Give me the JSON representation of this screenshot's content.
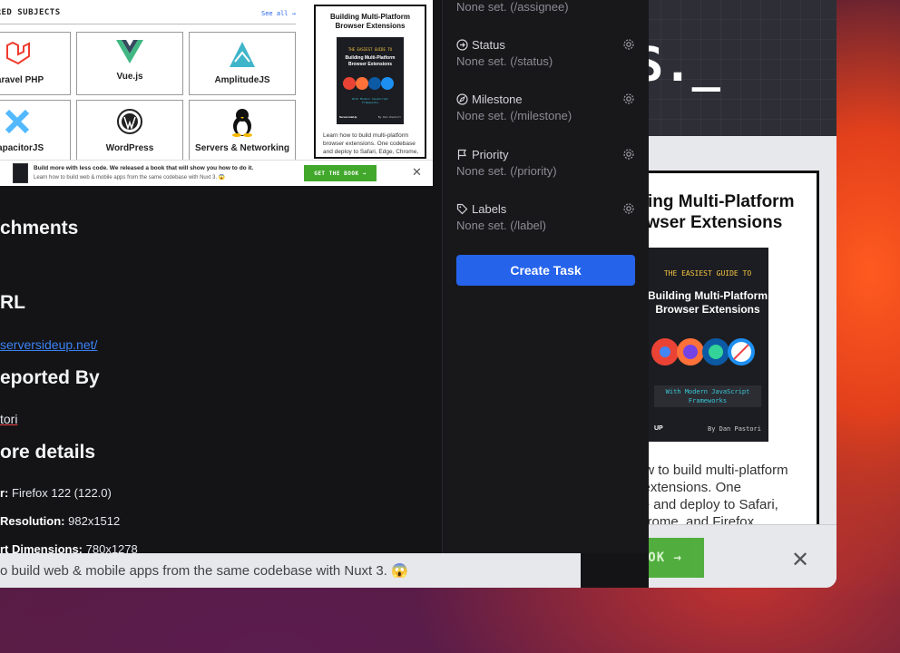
{
  "background_window": {
    "header_logo": "S._",
    "book_title": "Building Multi-Platform Browser Extensions",
    "cover_kicker": "THE EASIEST GUIDE TO",
    "cover_title": "Building Multi-Platform Browser Extensions",
    "cover_subtitle": "With Modern JavaScript Frameworks",
    "cover_brand": "UP",
    "cover_author": "By Dan Pastori",
    "book_description": "Learn how to build multi-platform browser extensions. One codebase and deploy to Safari, Edge, Chrome, and Firefox.",
    "banner_button": "GET THE BOOK →",
    "banner_close": "✕"
  },
  "preview": {
    "section_header": "FEATURED SUBJECTS",
    "see_all": "See all →",
    "subjects": [
      {
        "label": "Laravel PHP",
        "icon": "laravel-icon"
      },
      {
        "label": "Vue.js",
        "icon": "vue-icon"
      },
      {
        "label": "AmplitudeJS",
        "icon": "amplitude-icon"
      },
      {
        "label": "CapacitorJS",
        "icon": "capacitor-icon"
      },
      {
        "label": "WordPress",
        "icon": "wordpress-icon"
      },
      {
        "label": "Servers & Networking",
        "icon": "linux-icon"
      }
    ],
    "book_title": "Building Multi-Platform Browser Extensions",
    "cover_kicker": "THE EASIEST GUIDE TO",
    "cover_title": "Building Multi-Platform Browser Extensions",
    "cover_subtitle": "With Modern JavaScript Frameworks",
    "cover_brand": "ServersideUp",
    "cover_author": "By Dan Pastori",
    "book_description": "Learn how to build multi-platform browser extensions. One codebase and deploy to Safari, Edge, Chrome, and Firefox.",
    "promo_title": "Build more with less code. We released a book that will show you how to do it.",
    "promo_subtitle": "Learn how to build web & mobile apps from the same codebase with Nuxt 3. 😱",
    "promo_button": "GET THE BOOK →",
    "promo_close": "✕"
  },
  "details": {
    "attachments_heading": "chments",
    "url_heading": "RL",
    "url_value": "serversideup.net/",
    "reported_by_heading": "eported By",
    "reporter": "tori",
    "more_details_heading": "ore details",
    "browser_label": "r:",
    "browser_value": "Firefox 122 (122.0)",
    "resolution_label": "Resolution:",
    "resolution_value": "982x1512",
    "viewport_label": "rt Dimensions:",
    "viewport_value": "780x1278",
    "bottom_strip_text": "o build web & mobile apps from the same codebase with Nuxt 3. 😱"
  },
  "sidebar": {
    "assignee_value": "None set. (/assignee)",
    "fields": [
      {
        "label": "Status",
        "value": "None set. (/status)",
        "icon": "status-icon"
      },
      {
        "label": "Milestone",
        "value": "None set. (/milestone)",
        "icon": "milestone-icon"
      },
      {
        "label": "Priority",
        "value": "None set. (/priority)",
        "icon": "flag-icon"
      },
      {
        "label": "Labels",
        "value": "None set. (/label)",
        "icon": "tag-icon"
      }
    ],
    "create_button": "Create Task"
  },
  "colors": {
    "accent_blue": "#2563eb",
    "promo_green": "#41a82c",
    "app_background": "#141416",
    "sidebar_background": "#18181b"
  }
}
